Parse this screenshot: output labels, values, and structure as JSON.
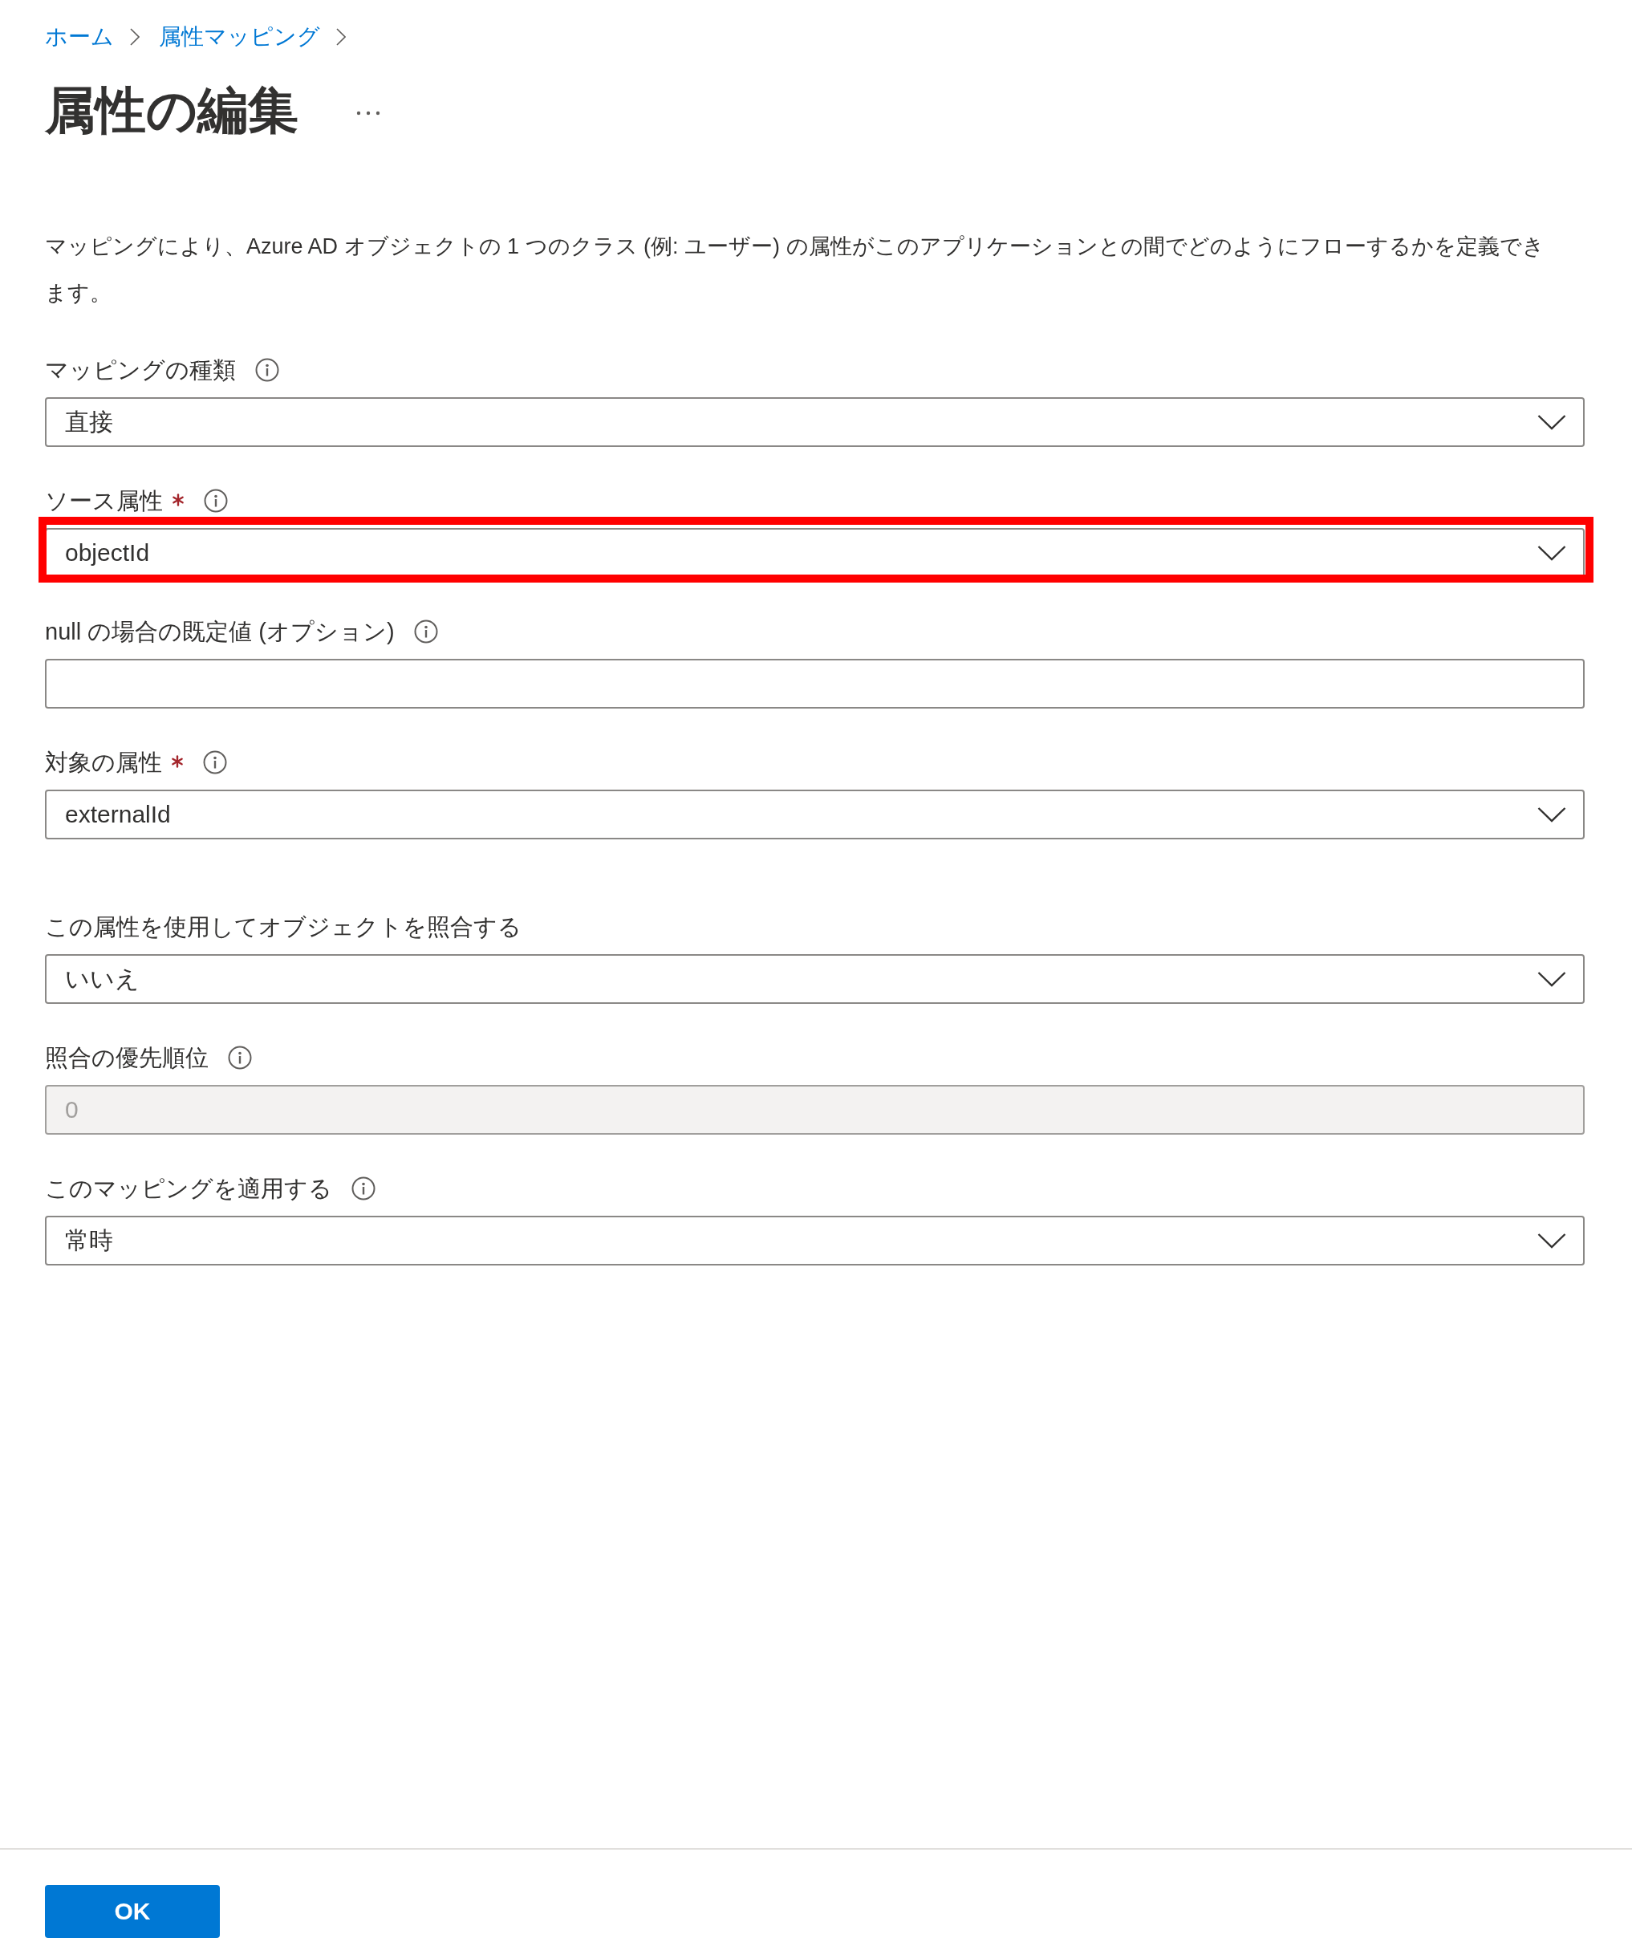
{
  "breadcrumb": [
    {
      "label": "ホーム"
    },
    {
      "label": "属性マッピング"
    }
  ],
  "title": "属性の編集",
  "description": "マッピングにより、Azure AD オブジェクトの 1 つのクラス (例: ユーザー) の属性がこのアプリケーションとの間でどのようにフローするかを定義できます。",
  "fields": [
    {
      "label": "マッピングの種類",
      "kind": "dropdown",
      "value": "直接",
      "required": false,
      "info": true,
      "disabled": false,
      "highlighted": false
    },
    {
      "label": "ソース属性",
      "kind": "dropdown",
      "value": "objectId",
      "required": true,
      "info": true,
      "disabled": false,
      "highlighted": true
    },
    {
      "label": "null の場合の既定値 (オプション)",
      "kind": "textbox",
      "required": false,
      "info": true,
      "disabled": false,
      "highlighted": false
    },
    {
      "label": "対象の属性",
      "kind": "dropdown",
      "value": "externalId",
      "required": true,
      "info": true,
      "disabled": false,
      "highlighted": false
    },
    {
      "label": "この属性を使用してオブジェクトを照合する",
      "kind": "dropdown",
      "value": "いいえ",
      "required": false,
      "info": false,
      "disabled": false,
      "highlighted": false
    },
    {
      "label": "照合の優先順位",
      "kind": "textbox",
      "value": "0",
      "required": false,
      "info": true,
      "disabled": true,
      "highlighted": false
    },
    {
      "label": "このマッピングを適用する",
      "kind": "dropdown",
      "value": "常時",
      "required": false,
      "info": true,
      "disabled": false,
      "highlighted": false
    }
  ],
  "ok_button": "OK"
}
